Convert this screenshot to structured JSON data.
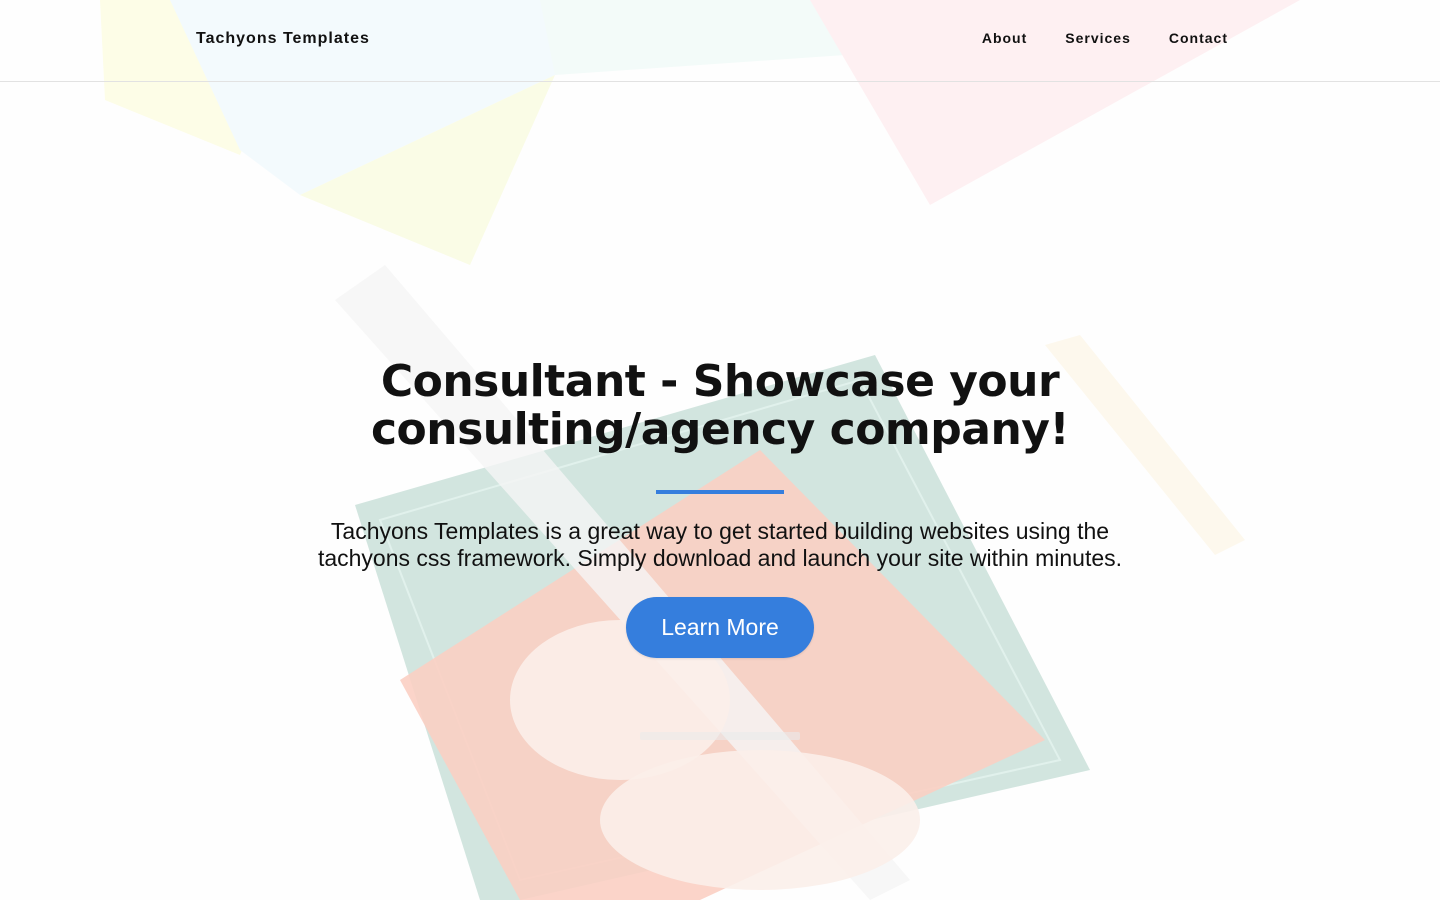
{
  "header": {
    "brand": "Tachyons Templates",
    "nav": [
      "About",
      "Services",
      "Contact"
    ]
  },
  "hero": {
    "title": "Consultant - Showcase your consulting/agency company!",
    "lede": "Tachyons Templates is a great way to get started building websites using the tachyons css framework. Simply download and launch your site within minutes.",
    "cta_label": "Learn More"
  },
  "colors": {
    "accent": "#357edd",
    "text": "#111111"
  }
}
